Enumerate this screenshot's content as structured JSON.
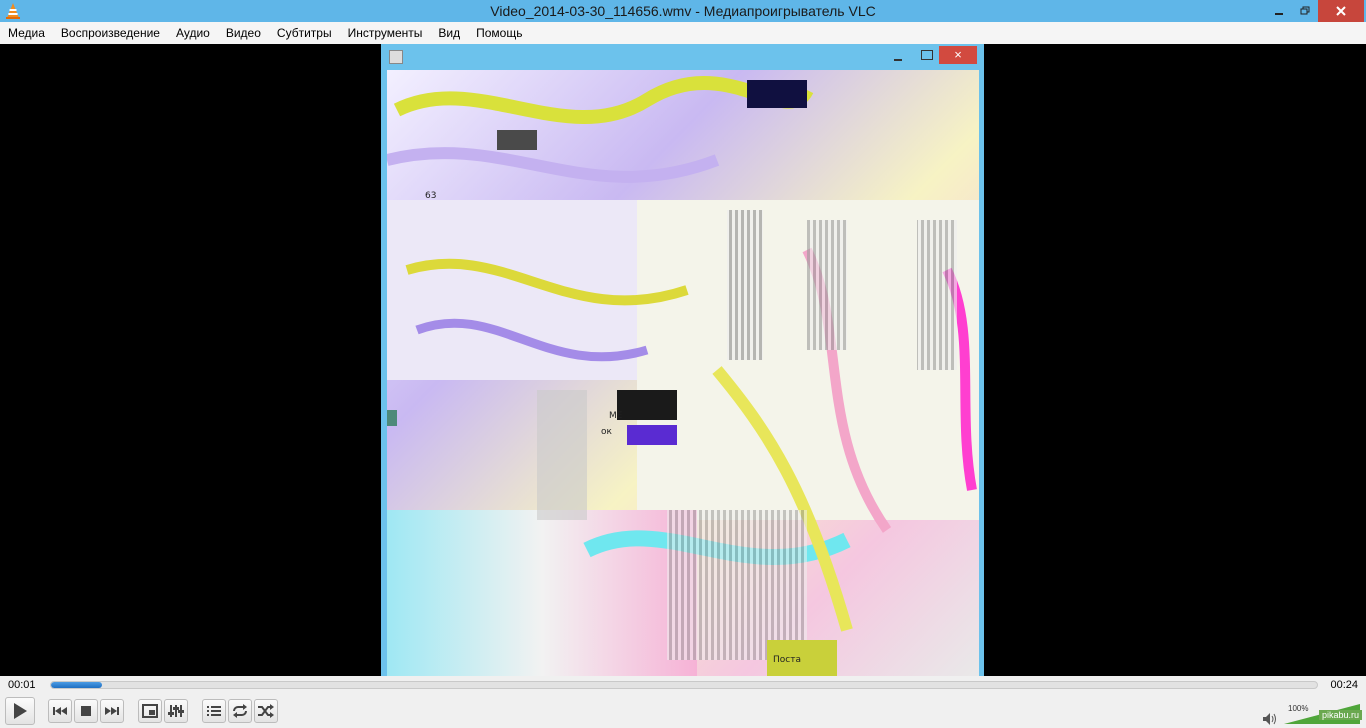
{
  "window": {
    "title": "Video_2014-03-30_114656.wmv - Медиапроигрыватель VLC",
    "icons": {
      "app": "vlc-cone-icon",
      "minimize": "minimize-icon",
      "maximize": "restore-icon",
      "close": "close-icon"
    }
  },
  "menu": [
    "Медиа",
    "Воспроизведение",
    "Аудио",
    "Видео",
    "Субтитры",
    "Инструменты",
    "Вид",
    "Помощь"
  ],
  "video": {
    "inner_window_close": "×",
    "glitch_labels": [
      "63",
      "ME",
      "ок",
      "Поста"
    ]
  },
  "seek": {
    "elapsed": "00:01",
    "total": "00:24",
    "progress": 0.04
  },
  "controls": {
    "buttons": [
      "play-icon",
      "previous-icon",
      "stop-icon",
      "next-icon",
      "fullscreen-icon",
      "extended-settings-icon",
      "playlist-icon",
      "loop-icon",
      "shuffle-icon"
    ]
  },
  "volume": {
    "percent_label": "100%",
    "level": 1.0
  },
  "watermark": "pikabu.ru",
  "colors": {
    "titlebar": "#5fb6e8",
    "close": "#c7463c",
    "seek_fill": "#2f80d0",
    "volume": "#4fa63a"
  }
}
